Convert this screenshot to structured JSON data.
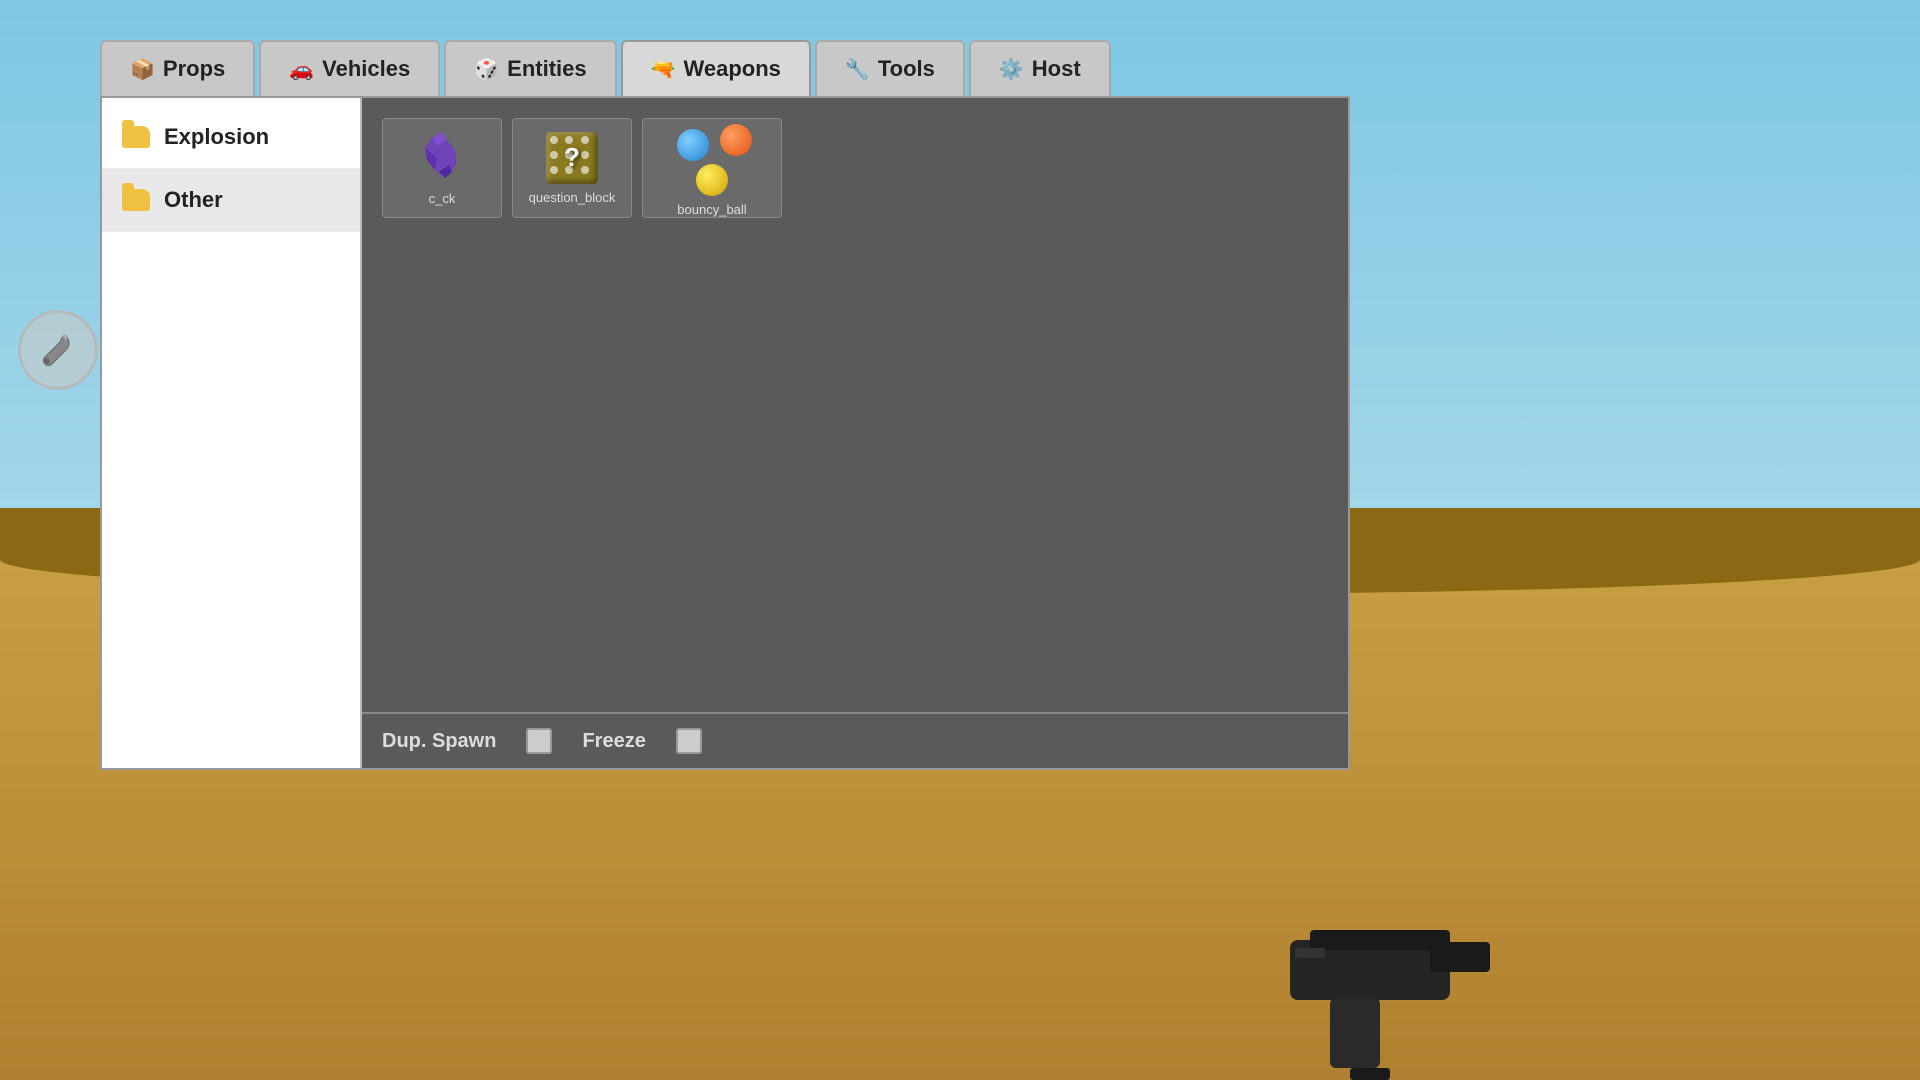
{
  "background": {
    "sky_color": "#7ec8e3",
    "ground_color": "#c8a042"
  },
  "tabs": [
    {
      "id": "props",
      "label": "Props",
      "icon": "📦",
      "active": false
    },
    {
      "id": "vehicles",
      "label": "Vehicles",
      "icon": "🚗",
      "active": false
    },
    {
      "id": "entities",
      "label": "Entities",
      "icon": "🎲",
      "active": false
    },
    {
      "id": "weapons",
      "label": "Weapons",
      "icon": "🔫",
      "active": true
    },
    {
      "id": "tools",
      "label": "Tools",
      "icon": "🔧",
      "active": false
    },
    {
      "id": "host",
      "label": "Host",
      "icon": "⚙️",
      "active": false
    }
  ],
  "sidebar": {
    "items": [
      {
        "id": "explosion",
        "label": "Explosion",
        "active": false
      },
      {
        "id": "other",
        "label": "Other",
        "active": true
      }
    ]
  },
  "items": [
    {
      "id": "c_ck",
      "label": "c_ck",
      "type": "purple_shape"
    },
    {
      "id": "question_block",
      "label": "question_block",
      "type": "question_block"
    },
    {
      "id": "bouncy_ball",
      "label": "bouncy_ball",
      "type": "bouncy_ball"
    }
  ],
  "bottom_bar": {
    "dup_spawn_label": "Dup. Spawn",
    "freeze_label": "Freeze"
  }
}
